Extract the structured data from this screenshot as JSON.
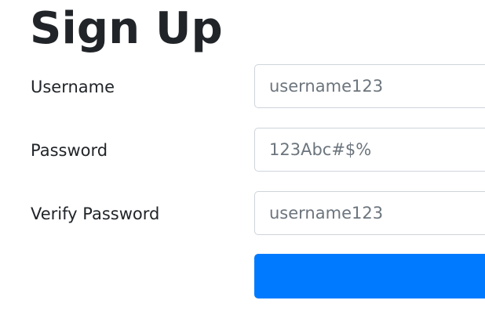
{
  "form": {
    "title": "Sign Up",
    "fields": {
      "username": {
        "label": "Username",
        "placeholder": "username123"
      },
      "password": {
        "label": "Password",
        "placeholder": "123Abc#$%"
      },
      "verify_password": {
        "label": "Verify Password",
        "placeholder": "username123"
      }
    },
    "submit": {
      "color": "#007bff"
    }
  }
}
